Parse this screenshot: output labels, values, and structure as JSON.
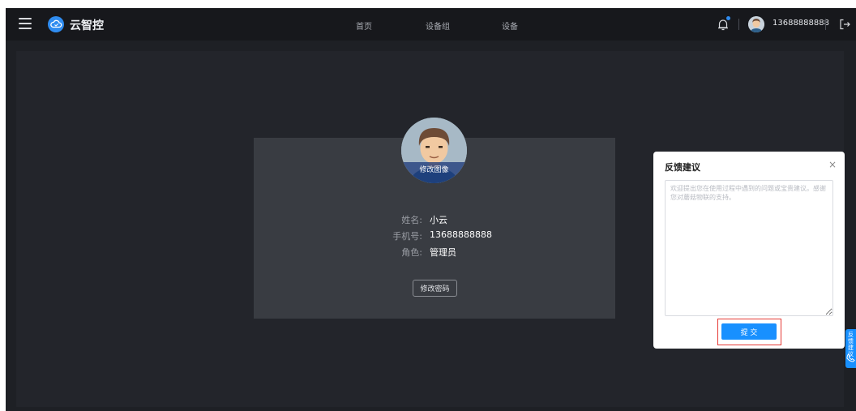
{
  "header": {
    "app_name": "云智控",
    "nav": [
      "首页",
      "设备组",
      "设备"
    ],
    "username": "13688888888"
  },
  "profile": {
    "avatar_edit_label": "修改图像",
    "fields": [
      {
        "label": "姓名:",
        "value": "小云"
      },
      {
        "label": "手机号:",
        "value": "13688888888"
      },
      {
        "label": "角色:",
        "value": "管理员"
      }
    ],
    "change_password_label": "修改密码"
  },
  "feedback": {
    "title": "反馈建议",
    "close_symbol": "×",
    "placeholder": "欢迎提出您在使用过程中遇到的问题或宝贵建议。感谢您对蘑菇物联的支持。",
    "submit_label": "提 交"
  },
  "side_tab": {
    "label": "反馈建议"
  },
  "colors": {
    "accent": "#1890ff",
    "header_bg": "#17181c",
    "content_bg": "#23252b",
    "card_bg": "#393c42",
    "highlight_border": "#e53935"
  },
  "icons": [
    "menu-icon",
    "cloud-logo-icon",
    "bell-icon",
    "logout-icon",
    "phone-icon"
  ]
}
